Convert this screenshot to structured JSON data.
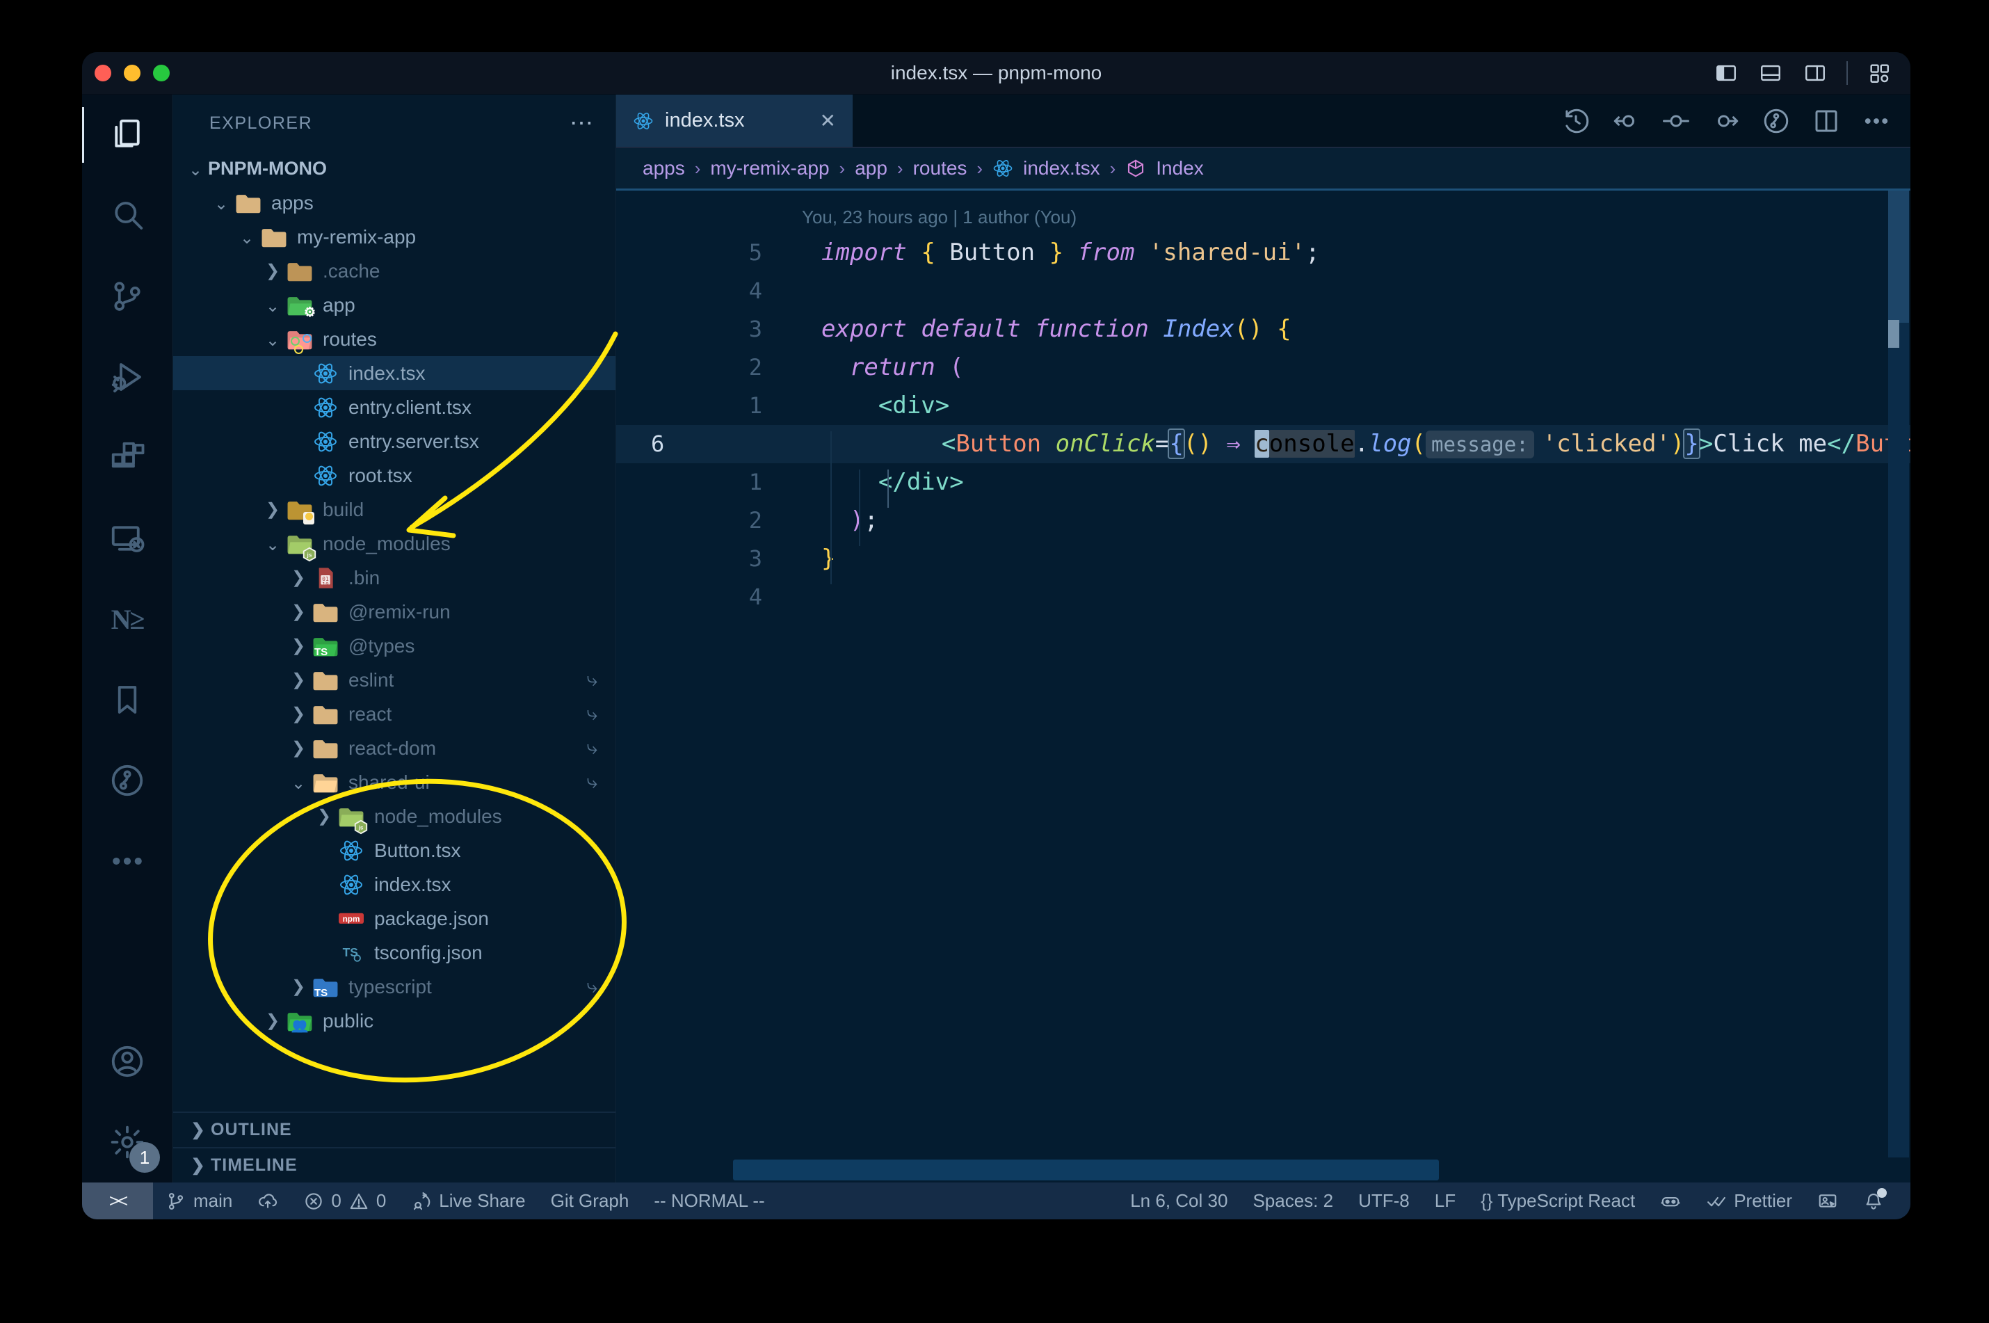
{
  "window": {
    "title": "index.tsx — pnpm-mono"
  },
  "titlebar_actions": [
    {
      "name": "toggle-primary-sidebar-icon"
    },
    {
      "name": "toggle-panel-icon"
    },
    {
      "name": "toggle-secondary-sidebar-icon"
    },
    {
      "name": "customize-layout-icon"
    }
  ],
  "activity_bar": {
    "items": [
      {
        "name": "explorer",
        "icon": "files-icon",
        "active": true
      },
      {
        "name": "search",
        "icon": "search-icon"
      },
      {
        "name": "source-control",
        "icon": "source-control-icon"
      },
      {
        "name": "run-debug",
        "icon": "debug-icon"
      },
      {
        "name": "extensions",
        "icon": "extensions-icon"
      },
      {
        "name": "remote-explorer",
        "icon": "remote-explorer-icon"
      },
      {
        "name": "nx-console",
        "icon": "nx-icon",
        "glyph": "N≥"
      },
      {
        "name": "bookmarks",
        "icon": "bookmark-icon"
      },
      {
        "name": "gitlens",
        "icon": "gitlens-icon"
      },
      {
        "name": "more-views",
        "icon": "ellipsis-icon"
      }
    ],
    "bottom": [
      {
        "name": "accounts",
        "icon": "account-icon"
      },
      {
        "name": "settings",
        "icon": "gear-icon",
        "badge": "1"
      }
    ]
  },
  "sidebar": {
    "header": "EXPLORER",
    "more": "⋯",
    "tree": [
      {
        "label": "PNPM-MONO",
        "level": 0,
        "chev": "v",
        "icon": "none",
        "bold": true
      },
      {
        "label": "apps",
        "level": 1,
        "chev": "v",
        "icon": "folder"
      },
      {
        "label": "my-remix-app",
        "level": 2,
        "chev": "v",
        "icon": "folder"
      },
      {
        "label": ".cache",
        "level": 3,
        "chev": ">",
        "icon": "folder-cache",
        "dim": true
      },
      {
        "label": "app",
        "level": 3,
        "chev": "v",
        "icon": "folder-app"
      },
      {
        "label": "routes",
        "level": 3,
        "chev": "v",
        "icon": "folder-routes"
      },
      {
        "label": "index.tsx",
        "level": 4,
        "chev": "",
        "icon": "react",
        "sel": true
      },
      {
        "label": "entry.client.tsx",
        "level": 4,
        "chev": "",
        "icon": "react"
      },
      {
        "label": "entry.server.tsx",
        "level": 4,
        "chev": "",
        "icon": "react"
      },
      {
        "label": "root.tsx",
        "level": 4,
        "chev": "",
        "icon": "react"
      },
      {
        "label": "build",
        "level": 3,
        "chev": ">",
        "icon": "folder-build",
        "dim": true
      },
      {
        "label": "node_modules",
        "level": 3,
        "chev": "v",
        "icon": "folder-nm",
        "dim": true
      },
      {
        "label": ".bin",
        "level": 4,
        "chev": ">",
        "icon": "bin",
        "dim": true
      },
      {
        "label": "@remix-run",
        "level": 4,
        "chev": ">",
        "icon": "folder",
        "dim": true
      },
      {
        "label": "@types",
        "level": 4,
        "chev": ">",
        "icon": "folder-types",
        "dim": true
      },
      {
        "label": "eslint",
        "level": 4,
        "chev": ">",
        "icon": "folder",
        "dim": true,
        "sym": true
      },
      {
        "label": "react",
        "level": 4,
        "chev": ">",
        "icon": "folder",
        "dim": true,
        "sym": true
      },
      {
        "label": "react-dom",
        "level": 4,
        "chev": ">",
        "icon": "folder",
        "dim": true,
        "sym": true
      },
      {
        "label": "shared-ui",
        "level": 4,
        "chev": "v",
        "icon": "folder-open",
        "dim": true,
        "sym": true
      },
      {
        "label": "node_modules",
        "level": 5,
        "chev": ">",
        "icon": "folder-nm",
        "dim": true
      },
      {
        "label": "Button.tsx",
        "level": 5,
        "chev": "",
        "icon": "react"
      },
      {
        "label": "index.tsx",
        "level": 5,
        "chev": "",
        "icon": "react"
      },
      {
        "label": "package.json",
        "level": 5,
        "chev": "",
        "icon": "npm"
      },
      {
        "label": "tsconfig.json",
        "level": 5,
        "chev": "",
        "icon": "tsjson"
      },
      {
        "label": "typescript",
        "level": 4,
        "chev": ">",
        "icon": "folder-ts",
        "dim": true,
        "sym": true
      },
      {
        "label": "public",
        "level": 3,
        "chev": ">",
        "icon": "folder-public"
      }
    ],
    "panels": [
      {
        "label": "OUTLINE"
      },
      {
        "label": "TIMELINE"
      }
    ]
  },
  "tabs": [
    {
      "label": "index.tsx",
      "icon": "react-icon",
      "close": "✕",
      "active": true
    }
  ],
  "editor_actions": [
    {
      "name": "file-history-icon"
    },
    {
      "name": "open-changes-previous-icon"
    },
    {
      "name": "open-changes-icon"
    },
    {
      "name": "open-changes-next-icon"
    },
    {
      "name": "gitlens-graph-icon"
    },
    {
      "name": "split-editor-icon"
    },
    {
      "name": "more-actions-icon"
    }
  ],
  "breadcrumbs": {
    "items": [
      "apps",
      "my-remix-app",
      "app",
      "routes",
      "index.tsx",
      "Index"
    ],
    "separator": "›"
  },
  "editor": {
    "codelens": "You, 23 hours ago | 1 author (You)",
    "lines": [
      {
        "gutter": "5",
        "tokens": [
          [
            "kw",
            "import"
          ],
          [
            "txt",
            " "
          ],
          [
            "p1",
            "{"
          ],
          [
            "txt",
            " Button "
          ],
          [
            "p1",
            "}"
          ],
          [
            "txt",
            " "
          ],
          [
            "kw",
            "from"
          ],
          [
            "txt",
            " "
          ],
          [
            "str",
            "'shared-ui'"
          ],
          [
            "txt",
            ";"
          ]
        ]
      },
      {
        "gutter": "4",
        "tokens": []
      },
      {
        "gutter": "3",
        "tokens": [
          [
            "kw",
            "export"
          ],
          [
            "txt",
            " "
          ],
          [
            "kw",
            "default"
          ],
          [
            "txt",
            " "
          ],
          [
            "kw",
            "function"
          ],
          [
            "txt",
            " "
          ],
          [
            "fn",
            "Index"
          ],
          [
            "p1",
            "()"
          ],
          [
            "txt",
            " "
          ],
          [
            "p1",
            "{"
          ]
        ]
      },
      {
        "gutter": "2",
        "tokens": [
          [
            "txt",
            "  "
          ],
          [
            "kw",
            "return"
          ],
          [
            "txt",
            " "
          ],
          [
            "p2",
            "("
          ]
        ]
      },
      {
        "gutter": "1",
        "tokens": [
          [
            "txt",
            "    "
          ],
          [
            "tag",
            "<div>"
          ]
        ]
      },
      {
        "gutter": "6",
        "current": true,
        "tokens": [
          [
            "txt",
            "      "
          ],
          [
            "tag",
            "<"
          ],
          [
            "comp",
            "Button"
          ],
          [
            "txt",
            " "
          ],
          [
            "attr",
            "onClick"
          ],
          [
            "txt",
            "="
          ],
          [
            "p3 box",
            "{"
          ],
          [
            "p1",
            "()"
          ],
          [
            "txt",
            " "
          ],
          [
            "arrow",
            "⇒"
          ],
          [
            "txt",
            " "
          ],
          [
            "cursor",
            "c"
          ],
          [
            "hl",
            "onsole"
          ],
          [
            "txt",
            "."
          ],
          [
            "fn",
            "log"
          ],
          [
            "p1",
            "("
          ],
          [
            "inlay",
            "message:"
          ],
          [
            "str",
            "'clicked'"
          ],
          [
            "p1",
            ")"
          ],
          [
            "p3 box",
            "}"
          ],
          [
            "tag",
            ">"
          ],
          [
            "txt",
            "Click me"
          ],
          [
            "tag",
            "</"
          ],
          [
            "comp",
            "Button"
          ],
          [
            "tag",
            ">"
          ]
        ]
      },
      {
        "gutter": "1",
        "tokens": [
          [
            "txt",
            "    "
          ],
          [
            "tag",
            "</div>"
          ]
        ]
      },
      {
        "gutter": "2",
        "tokens": [
          [
            "txt",
            "  "
          ],
          [
            "p2",
            ")"
          ],
          [
            "txt",
            ";"
          ]
        ]
      },
      {
        "gutter": "3",
        "tokens": [
          [
            "p1",
            "}"
          ]
        ]
      },
      {
        "gutter": "4",
        "tokens": []
      }
    ]
  },
  "status_bar": {
    "left": [
      {
        "name": "remote-indicator",
        "glyph": "><",
        "chip": true
      },
      {
        "name": "git-branch",
        "icon": "branch-icon",
        "label": "main"
      },
      {
        "name": "publish",
        "icon": "cloud-upload-icon",
        "label": ""
      },
      {
        "name": "problems",
        "icon": "error-icon",
        "label": "0",
        "icon2": "warning-icon",
        "label2": "0"
      },
      {
        "name": "live-share",
        "icon": "live-share-icon",
        "label": "Live Share"
      },
      {
        "name": "git-graph",
        "label": "Git Graph"
      },
      {
        "name": "vim-mode",
        "label": "-- NORMAL --"
      }
    ],
    "right": [
      {
        "name": "cursor-position",
        "label": "Ln 6, Col 30"
      },
      {
        "name": "indentation",
        "label": "Spaces: 2"
      },
      {
        "name": "encoding",
        "label": "UTF-8"
      },
      {
        "name": "eol",
        "label": "LF"
      },
      {
        "name": "language-mode",
        "label": "{} TypeScript React"
      },
      {
        "name": "copilot",
        "icon": "copilot-icon",
        "label": ""
      },
      {
        "name": "prettier",
        "icon": "double-check-icon",
        "label": "Prettier"
      },
      {
        "name": "feedback",
        "icon": "person-screen-icon",
        "label": ""
      },
      {
        "name": "notifications",
        "icon": "bell-icon",
        "label": "",
        "dot": true
      }
    ]
  },
  "annotations": {
    "color": "#ffe70c",
    "shapes": [
      "arrow-to-node-modules",
      "ellipse-around-shared-ui"
    ]
  },
  "colors": {
    "editor_bg": "#041c30",
    "sidebar_bg": "#051a2c",
    "activitybar_bg": "#04101d",
    "titlebar_bg": "#0c1420",
    "statusbar_bg": "#152c47",
    "active_tab_bg": "#16334f",
    "selection_row": "#10304c",
    "keyword": "#c792ea",
    "string": "#ecc48d",
    "component": "#f78c6c",
    "attribute": "#addb67",
    "tag": "#7fdbca",
    "function": "#82aaff",
    "bracket_gold": "#ffd34d",
    "annotation_yellow": "#ffe70c",
    "traffic_red": "#ff5f56",
    "traffic_yellow": "#ffbd2e",
    "traffic_green": "#27c93f"
  }
}
